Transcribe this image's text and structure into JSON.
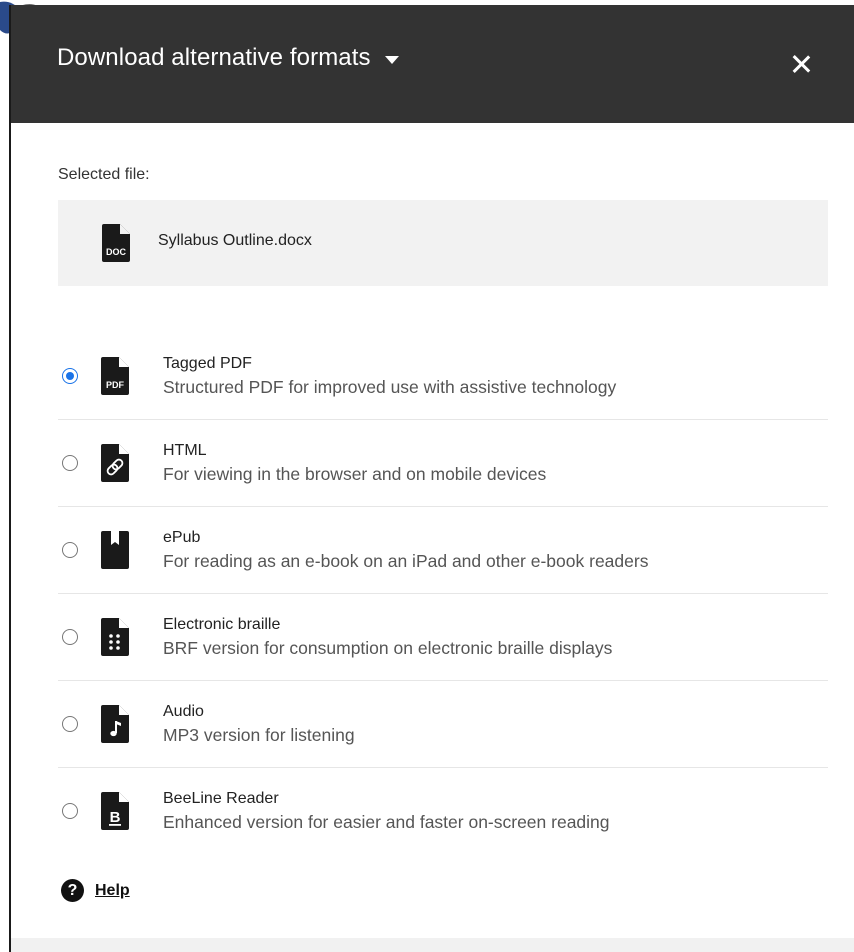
{
  "dialog": {
    "title": "Download alternative formats",
    "close_icon": "close-icon",
    "caret_icon": "caret-down-icon"
  },
  "selected_file": {
    "label": "Selected file:",
    "name": "Syllabus Outline.docx",
    "icon": "doc-file-icon",
    "icon_text": "DOC"
  },
  "options": [
    {
      "title": "Tagged PDF",
      "description": "Structured PDF for improved use with assistive technology",
      "icon": "pdf-file-icon",
      "icon_text": "PDF",
      "selected": true
    },
    {
      "title": "HTML",
      "description": "For viewing in the browser and on mobile devices",
      "icon": "html-link-file-icon",
      "selected": false
    },
    {
      "title": "ePub",
      "description": "For reading as an e-book on an iPad and other e-book readers",
      "icon": "epub-book-icon",
      "selected": false
    },
    {
      "title": "Electronic braille",
      "description": "BRF version for consumption on electronic braille displays",
      "icon": "braille-file-icon",
      "selected": false
    },
    {
      "title": "Audio",
      "description": "MP3 version for listening",
      "icon": "audio-file-icon",
      "selected": false
    },
    {
      "title": "BeeLine Reader",
      "description": "Enhanced version for easier and faster on-screen reading",
      "icon": "beeline-file-icon",
      "icon_text": "B",
      "selected": false
    }
  ],
  "help": {
    "label": "Help",
    "icon": "help-icon",
    "icon_text": "?"
  },
  "colors": {
    "header_bg": "#333333",
    "accent": "#1a73e8",
    "file_box_bg": "#f2f2f2"
  }
}
